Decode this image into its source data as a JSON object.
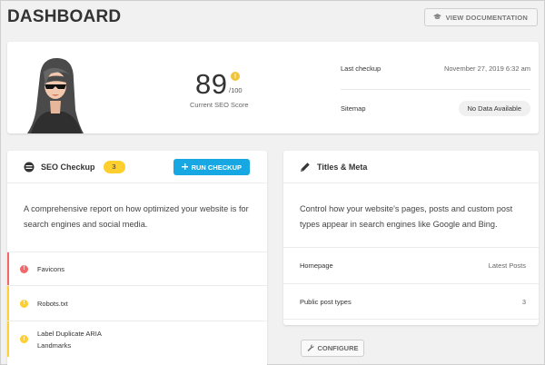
{
  "header": {
    "title": "DASHBOARD",
    "doc_button_label": "VIEW DOCUMENTATION"
  },
  "summary": {
    "score": "89",
    "score_max": "/100",
    "score_label": "Current SEO Score",
    "score_dot": "!",
    "last_checkup_label": "Last checkup",
    "last_checkup_value": "November 27, 2019 6:32 am",
    "sitemap_label": "Sitemap",
    "sitemap_value": "No Data Available"
  },
  "seo_checkup": {
    "title": "SEO Checkup",
    "count": "3",
    "run_button_label": "RUN CHECKUP",
    "description": "A comprehensive report on how optimized your website is for search engines and social media.",
    "items": [
      {
        "label": "Favicons",
        "status": "error",
        "color": "#f2676a"
      },
      {
        "label": "Robots.txt",
        "status": "warning",
        "color": "#fecf2f"
      },
      {
        "label": "Label Duplicate ARIA Landmarks",
        "status": "warning",
        "color": "#fecf2f"
      }
    ]
  },
  "titles_meta": {
    "title": "Titles & Meta",
    "description": "Control how your website's pages, posts and custom post types appear in search engines like Google and Bing.",
    "rows": [
      {
        "label": "Homepage",
        "value": "Latest Posts"
      },
      {
        "label": "Public post types",
        "value": "3"
      }
    ],
    "configure_label": "CONFIGURE"
  },
  "colors": {
    "accent_blue": "#17a8e3",
    "warning_yellow": "#fecf2f",
    "error_red": "#f2676a"
  },
  "icons": [
    "graduation-cap-icon",
    "warning-icon",
    "seo-checkup-icon",
    "plus-icon",
    "pencil-icon",
    "wrench-icon"
  ]
}
